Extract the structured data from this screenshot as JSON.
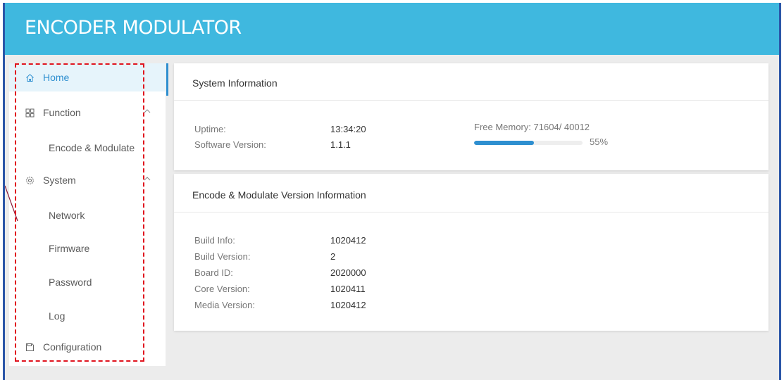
{
  "app": {
    "title": "ENCODER MODULATOR"
  },
  "sidebar": {
    "items": [
      {
        "label": "Home",
        "icon": "home-icon",
        "active": true
      },
      {
        "label": "Function",
        "icon": "grid-icon",
        "expanded": true
      },
      {
        "label": "Encode & Modulate",
        "sub": true
      },
      {
        "label": "System",
        "icon": "gear-icon",
        "expanded": true
      },
      {
        "label": "Network",
        "sub": true
      },
      {
        "label": "Firmware",
        "sub": true
      },
      {
        "label": "Password",
        "sub": true
      },
      {
        "label": "Log",
        "sub": true
      },
      {
        "label": "Configuration",
        "icon": "save-icon"
      }
    ]
  },
  "system_info": {
    "title": "System Information",
    "uptime_label": "Uptime:",
    "uptime_value": "13:34:20",
    "software_version_label": "Software Version:",
    "software_version_value": "1.1.1",
    "free_memory_text": "Free Memory: 71604/ 40012",
    "memory_percent_text": "55%",
    "memory_fraction": 0.55
  },
  "version_info": {
    "title": "Encode & Modulate Version Information",
    "rows": [
      {
        "label": "Build Info:",
        "value": "1020412"
      },
      {
        "label": "Build Version:",
        "value": "2"
      },
      {
        "label": "Board ID:",
        "value": "2020000"
      },
      {
        "label": "Core Version:",
        "value": "1020411"
      },
      {
        "label": "Media Version:",
        "value": "1020412"
      }
    ]
  },
  "colors": {
    "header": "#3fb8df",
    "accent": "#2e8fd0",
    "highlight_dash": "#e0141e"
  }
}
